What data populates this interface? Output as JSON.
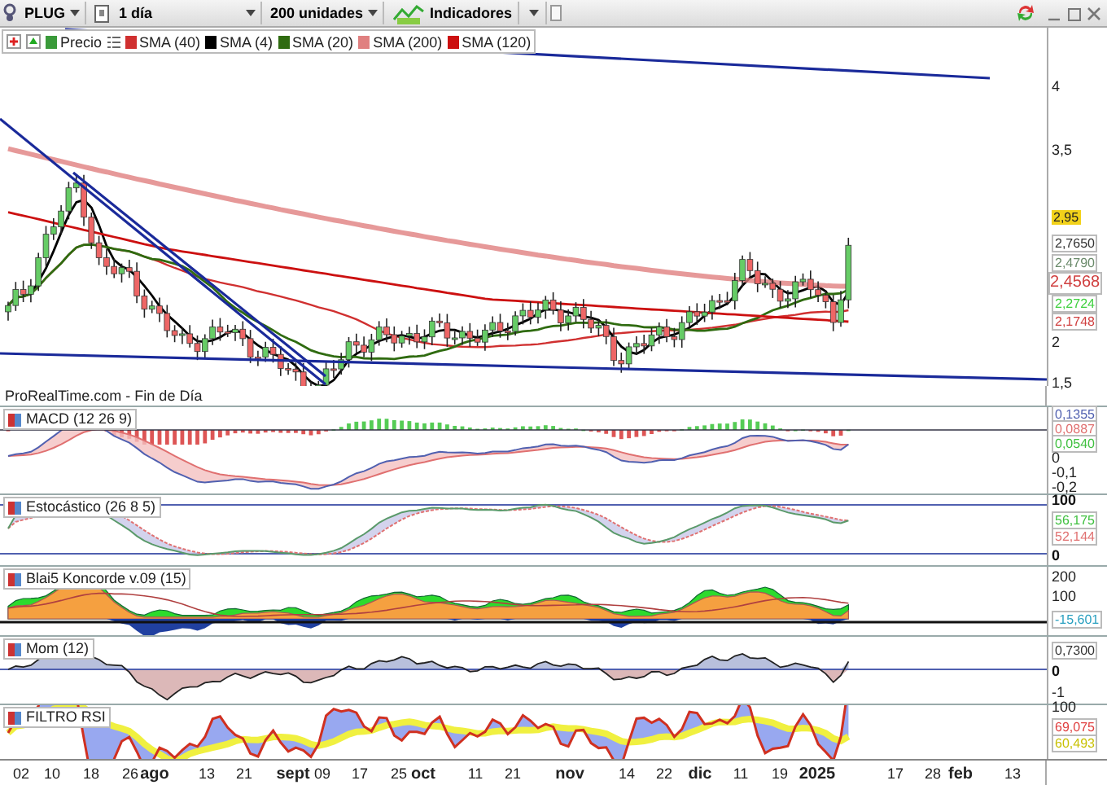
{
  "toolbar": {
    "symbol": "PLUG",
    "period": "1 día",
    "units": "200 unidades",
    "indicators": "Indicadores"
  },
  "legend": [
    {
      "label": "Precio",
      "color": "#3a9a3a"
    },
    {
      "label": "SMA (40)",
      "color": "#d03030"
    },
    {
      "label": "SMA (4)",
      "color": "#000000"
    },
    {
      "label": "SMA (20)",
      "color": "#2f6b10"
    },
    {
      "label": "SMA (200)",
      "color": "#e08080"
    },
    {
      "label": "SMA (120)",
      "color": "#cc1010"
    }
  ],
  "main": {
    "axis": [
      {
        "text": "4",
        "kind": "tick"
      },
      {
        "text": "3,5",
        "kind": "tick"
      },
      {
        "text": "2,95",
        "kind": "highlight",
        "color": "#f2d21a"
      },
      {
        "text": "2,7650",
        "kind": "badge",
        "color": "#333333"
      },
      {
        "text": "2,4790",
        "kind": "badge",
        "color": "#6a8a6a"
      },
      {
        "text": "2,4568",
        "kind": "big",
        "color": "#d04040"
      },
      {
        "text": "2,2724",
        "kind": "badge",
        "color": "#40d040"
      },
      {
        "text": "2,1748",
        "kind": "badge",
        "color": "#d04040"
      },
      {
        "text": "2",
        "kind": "tick"
      },
      {
        "text": "1,5",
        "kind": "tick"
      }
    ]
  },
  "source": "ProRealTime.com - Fin de Día",
  "panels": [
    {
      "title": "MACD (12 26 9)",
      "kind": "macd",
      "axis": [
        {
          "text": "0,1355",
          "kind": "badge",
          "color": "#5060b0"
        },
        {
          "text": "0,0887",
          "kind": "badge",
          "color": "#e07070"
        },
        {
          "text": "0,0540",
          "kind": "badge",
          "color": "#40c040"
        },
        {
          "text": "0",
          "kind": "tick"
        },
        {
          "text": "-0,1",
          "kind": "tick"
        },
        {
          "text": "-0,2",
          "kind": "tick"
        }
      ]
    },
    {
      "title": "Estocástico (26 8 5)",
      "kind": "stochastic",
      "axis": [
        {
          "text": "100",
          "kind": "bold"
        },
        {
          "text": "56,175",
          "kind": "badge",
          "color": "#40c040"
        },
        {
          "text": "52,144",
          "kind": "badge",
          "color": "#e07070"
        },
        {
          "text": "0",
          "kind": "bold"
        }
      ]
    },
    {
      "title": "Blai5 Koncorde v.09 (15)",
      "kind": "koncorde",
      "axis": [
        {
          "text": "200",
          "kind": "tick"
        },
        {
          "text": "100",
          "kind": "tick"
        },
        {
          "text": "-15,601",
          "kind": "badge",
          "color": "#2aa0c0"
        }
      ]
    },
    {
      "title": "Mom (12)",
      "kind": "momentum",
      "axis": [
        {
          "text": "0,7300",
          "kind": "badge",
          "color": "#333333"
        },
        {
          "text": "0",
          "kind": "bold"
        },
        {
          "text": "-1",
          "kind": "tick"
        }
      ]
    },
    {
      "title": "FILTRO RSI",
      "kind": "rsi",
      "axis": [
        {
          "text": "100",
          "kind": "tick"
        },
        {
          "text": "69,075",
          "kind": "badge",
          "color": "#e04040"
        },
        {
          "text": "60,493",
          "kind": "badge",
          "color": "#c8c000"
        }
      ]
    }
  ],
  "x_axis": [
    {
      "text": "02",
      "major": false
    },
    {
      "text": "10",
      "major": false
    },
    {
      "text": "18",
      "major": false
    },
    {
      "text": "26",
      "major": false
    },
    {
      "text": "ago",
      "major": true
    },
    {
      "text": "13",
      "major": false
    },
    {
      "text": "21",
      "major": false
    },
    {
      "text": "sept",
      "major": true
    },
    {
      "text": "09",
      "major": false
    },
    {
      "text": "17",
      "major": false
    },
    {
      "text": "25",
      "major": false
    },
    {
      "text": "oct",
      "major": true
    },
    {
      "text": "11",
      "major": false
    },
    {
      "text": "21",
      "major": false
    },
    {
      "text": "nov",
      "major": true
    },
    {
      "text": "14",
      "major": false
    },
    {
      "text": "22",
      "major": false
    },
    {
      "text": "dic",
      "major": true
    },
    {
      "text": "11",
      "major": false
    },
    {
      "text": "19",
      "major": false
    },
    {
      "text": "2025",
      "major": true
    },
    {
      "text": "17",
      "major": false
    },
    {
      "text": "28",
      "major": false
    },
    {
      "text": "feb",
      "major": true
    },
    {
      "text": "13",
      "major": false
    }
  ]
}
